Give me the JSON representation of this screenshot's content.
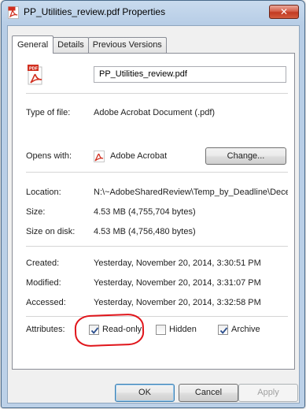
{
  "window": {
    "title": "PP_Utilities_review.pdf Properties",
    "close_glyph": "✕"
  },
  "tabs": [
    {
      "label": "General",
      "active": true
    },
    {
      "label": "Details",
      "active": false
    },
    {
      "label": "Previous Versions",
      "active": false
    }
  ],
  "general": {
    "file_name": "PP_Utilities_review.pdf",
    "file_icon": "pdf-file-icon",
    "type_label": "Type of file:",
    "type_value": "Adobe Acrobat Document (.pdf)",
    "opens_label": "Opens with:",
    "opens_value": "Adobe Acrobat",
    "change_label": "Change...",
    "location_label": "Location:",
    "location_value": "N:\\~AdobeSharedReview\\Temp_by_Deadline\\Dece",
    "size_label": "Size:",
    "size_value": "4.53 MB (4,755,704 bytes)",
    "size_disk_label": "Size on disk:",
    "size_disk_value": "4.53 MB (4,756,480 bytes)",
    "created_label": "Created:",
    "created_value": "Yesterday, November 20, 2014, 3:30:51 PM",
    "modified_label": "Modified:",
    "modified_value": "Yesterday, November 20, 2014, 3:31:07 PM",
    "accessed_label": "Accessed:",
    "accessed_value": "Yesterday, November 20, 2014, 3:32:58 PM",
    "attributes_label": "Attributes:",
    "readonly_label": "Read-only",
    "readonly_checked": true,
    "hidden_label": "Hidden",
    "hidden_checked": false,
    "archive_label": "Archive",
    "archive_checked": true
  },
  "buttons": {
    "ok": "OK",
    "cancel": "Cancel",
    "apply": "Apply"
  },
  "colors": {
    "highlight": "#e0151b",
    "pdf_red": "#d12f1f"
  }
}
